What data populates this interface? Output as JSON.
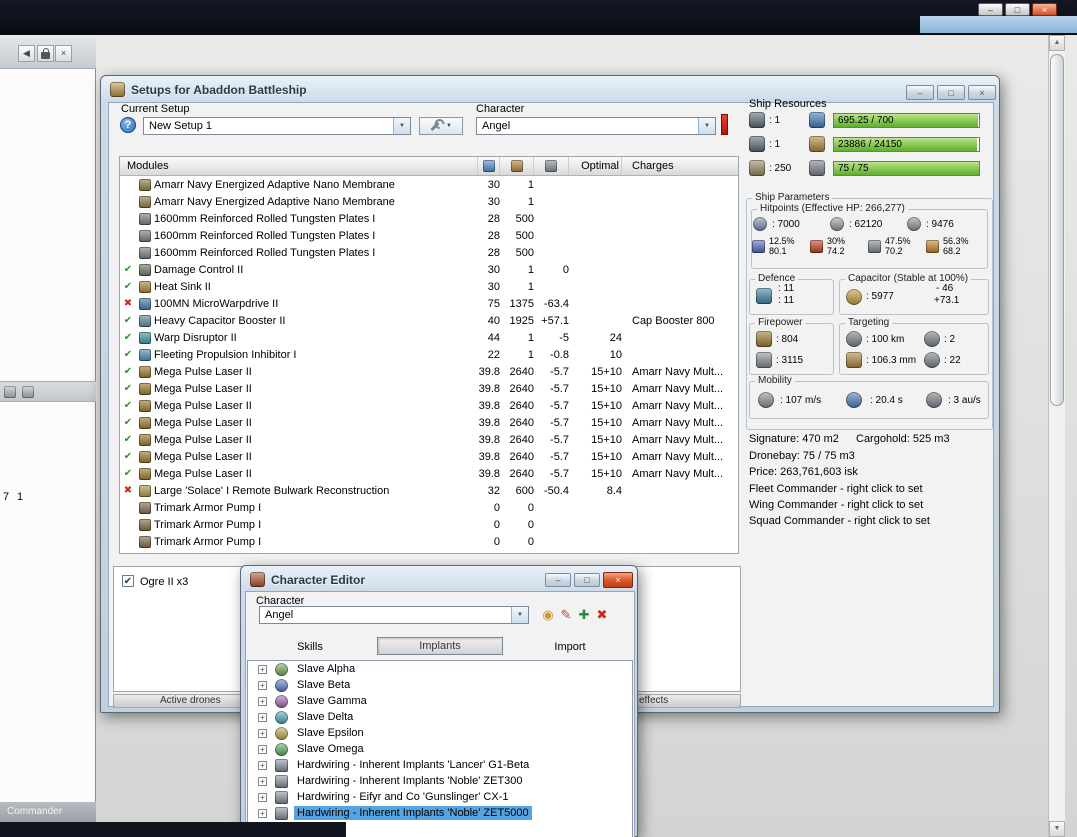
{
  "screen": {
    "topbar_buttons": {
      "minimize": "–",
      "maximize": "□",
      "close": "×"
    },
    "scrollbar": {
      "up": "▲",
      "down": "▼"
    }
  },
  "left_panel": {
    "back_button": "◀",
    "close_button": "×",
    "n1": "7",
    "n2": "1",
    "commander_label": "Commander"
  },
  "setup_window": {
    "title": "Setups for Abaddon Battleship",
    "window_buttons": {
      "minimize": "–",
      "maximize": "□",
      "close": "×"
    },
    "current_setup_label": "Current Setup",
    "current_setup_value": "New Setup 1",
    "character_label": "Character",
    "character_value": "Angel",
    "dropdown_arrow": "▼",
    "help_glyph": "?",
    "table": {
      "modules_header": "Modules",
      "optimal_header": "Optimal",
      "charges_header": "Charges",
      "rows": [
        {
          "st": "",
          "stc": "",
          "ic": "#93804a",
          "name": "Amarr Navy Energized Adaptive Nano Membrane",
          "cpu": "30",
          "pg": "1",
          "cap": "",
          "opt": "",
          "chg": ""
        },
        {
          "st": "",
          "stc": "",
          "ic": "#93804a",
          "name": "Amarr Navy Energized Adaptive Nano Membrane",
          "cpu": "30",
          "pg": "1",
          "cap": "",
          "opt": "",
          "chg": ""
        },
        {
          "st": "",
          "stc": "",
          "ic": "#7d828a",
          "name": "1600mm Reinforced Rolled Tungsten Plates I",
          "cpu": "28",
          "pg": "500",
          "cap": "",
          "opt": "",
          "chg": ""
        },
        {
          "st": "",
          "stc": "",
          "ic": "#7d828a",
          "name": "1600mm Reinforced Rolled Tungsten Plates I",
          "cpu": "28",
          "pg": "500",
          "cap": "",
          "opt": "",
          "chg": ""
        },
        {
          "st": "",
          "stc": "",
          "ic": "#7d828a",
          "name": "1600mm Reinforced Rolled Tungsten Plates I",
          "cpu": "28",
          "pg": "500",
          "cap": "",
          "opt": "",
          "chg": ""
        },
        {
          "st": "✔",
          "stc": "#1f9e1f",
          "ic": "#6f7d6a",
          "name": "Damage Control II",
          "cpu": "30",
          "pg": "1",
          "cap": "0",
          "opt": "",
          "chg": ""
        },
        {
          "st": "✔",
          "stc": "#1f9e1f",
          "ic": "#b08a3a",
          "name": "Heat Sink II",
          "cpu": "30",
          "pg": "1",
          "cap": "",
          "opt": "",
          "chg": ""
        },
        {
          "st": "✖",
          "stc": "#cc2a1a",
          "ic": "#4a7fb5",
          "name": "100MN MicroWarpdrive II",
          "cpu": "75",
          "pg": "1375",
          "cap": "-63.4",
          "opt": "",
          "chg": ""
        },
        {
          "st": "✔",
          "stc": "#1f9e1f",
          "ic": "#5f8fa5",
          "name": "Heavy Capacitor Booster II",
          "cpu": "40",
          "pg": "1925",
          "cap": "+57.1",
          "opt": "",
          "chg": "Cap Booster 800"
        },
        {
          "st": "✔",
          "stc": "#1f9e1f",
          "ic": "#3f9fa5",
          "name": "Warp Disruptor II",
          "cpu": "44",
          "pg": "1",
          "cap": "-5",
          "opt": "24",
          "chg": ""
        },
        {
          "st": "✔",
          "stc": "#1f9e1f",
          "ic": "#4f95b5",
          "name": "Fleeting Propulsion Inhibitor I",
          "cpu": "22",
          "pg": "1",
          "cap": "-0.8",
          "opt": "10",
          "chg": ""
        },
        {
          "st": "✔",
          "stc": "#1f9e1f",
          "ic": "#a08030",
          "name": "Mega Pulse Laser II",
          "cpu": "39.8",
          "pg": "2640",
          "cap": "-5.7",
          "opt": "15+10",
          "chg": "Amarr Navy Mult..."
        },
        {
          "st": "✔",
          "stc": "#1f9e1f",
          "ic": "#a08030",
          "name": "Mega Pulse Laser II",
          "cpu": "39.8",
          "pg": "2640",
          "cap": "-5.7",
          "opt": "15+10",
          "chg": "Amarr Navy Mult..."
        },
        {
          "st": "✔",
          "stc": "#1f9e1f",
          "ic": "#a08030",
          "name": "Mega Pulse Laser II",
          "cpu": "39.8",
          "pg": "2640",
          "cap": "-5.7",
          "opt": "15+10",
          "chg": "Amarr Navy Mult..."
        },
        {
          "st": "✔",
          "stc": "#1f9e1f",
          "ic": "#a08030",
          "name": "Mega Pulse Laser II",
          "cpu": "39.8",
          "pg": "2640",
          "cap": "-5.7",
          "opt": "15+10",
          "chg": "Amarr Navy Mult..."
        },
        {
          "st": "✔",
          "stc": "#1f9e1f",
          "ic": "#a08030",
          "name": "Mega Pulse Laser II",
          "cpu": "39.8",
          "pg": "2640",
          "cap": "-5.7",
          "opt": "15+10",
          "chg": "Amarr Navy Mult..."
        },
        {
          "st": "✔",
          "stc": "#1f9e1f",
          "ic": "#a08030",
          "name": "Mega Pulse Laser II",
          "cpu": "39.8",
          "pg": "2640",
          "cap": "-5.7",
          "opt": "15+10",
          "chg": "Amarr Navy Mult..."
        },
        {
          "st": "✔",
          "stc": "#1f9e1f",
          "ic": "#a08030",
          "name": "Mega Pulse Laser II",
          "cpu": "39.8",
          "pg": "2640",
          "cap": "-5.7",
          "opt": "15+10",
          "chg": "Amarr Navy Mult..."
        },
        {
          "st": "✖",
          "stc": "#cc2a1a",
          "ic": "#b0a04a",
          "name": "Large 'Solace' I Remote Bulwark Reconstruction",
          "cpu": "32",
          "pg": "600",
          "cap": "-50.4",
          "opt": "8.4",
          "chg": ""
        },
        {
          "st": "",
          "stc": "",
          "ic": "#8a6f4f",
          "name": "Trimark Armor Pump I",
          "cpu": "0",
          "pg": "0",
          "cap": "",
          "opt": "",
          "chg": ""
        },
        {
          "st": "",
          "stc": "",
          "ic": "#8a6f4f",
          "name": "Trimark Armor Pump I",
          "cpu": "0",
          "pg": "0",
          "cap": "",
          "opt": "",
          "chg": ""
        },
        {
          "st": "",
          "stc": "",
          "ic": "#8a6f4f",
          "name": "Trimark Armor Pump I",
          "cpu": "0",
          "pg": "0",
          "cap": "",
          "opt": "",
          "chg": ""
        }
      ]
    },
    "drones": {
      "item_label": "Ogre II x3",
      "checked_glyph": "✔",
      "footer_left": "Active drones",
      "footer_right": "effects"
    },
    "resources": {
      "title": "Ship Resources",
      "rows": [
        {
          "count": ": 1",
          "ic1": "#5f6c78",
          "ic2": "#3f7fc0",
          "bar": "695.25 / 700",
          "fill": "99.3%"
        },
        {
          "count": ": 1",
          "ic1": "#5f6c78",
          "ic2": "#b5893f",
          "bar": "23886 / 24150",
          "fill": "98.9%"
        },
        {
          "count": ": 250",
          "ic1": "#9a8f5f",
          "ic2": "#7d848c",
          "bar": "75 / 75",
          "fill": "100%"
        }
      ]
    },
    "parameters": {
      "title": "Ship Parameters",
      "hitpoints_title": "Hitpoints (Effective HP: 266,277)",
      "hp": [
        {
          "v": ": 7000",
          "ic": "#7a94b8"
        },
        {
          "v": ": 62120",
          "ic": "#9aa0a8"
        },
        {
          "v": ": 9476",
          "ic": "#8f97a0"
        }
      ],
      "resists": [
        {
          "pct": "12.5%",
          "val": "80.1",
          "ic": "#5b6fc8"
        },
        {
          "pct": "30%",
          "val": "74.2",
          "ic": "#cc4422"
        },
        {
          "pct": "47.5%",
          "val": "70.2",
          "ic": "#888f98"
        },
        {
          "pct": "56.3%",
          "val": "68.2",
          "ic": "#d08828"
        }
      ],
      "defence": {
        "title": "Defence",
        "v1": ": 11",
        "v2": ": 11"
      },
      "capacitor": {
        "title": "Capacitor (Stable at 100%)",
        "v1": ": 5977",
        "v2": "- 46",
        "v3": "+73.1"
      },
      "firepower": {
        "title": "Firepower",
        "v1": ": 804",
        "v2": ": 3115"
      },
      "targeting": {
        "title": "Targeting",
        "v1": ": 100 km",
        "v2": ": 2",
        "v3": ": 106.3 mm",
        "v4": ": 22"
      },
      "mobility": {
        "title": "Mobility",
        "v1": ": 107 m/s",
        "v2": ": 20.4 s",
        "v3": ": 3 au/s"
      }
    },
    "stats": {
      "signature": "Signature: 470 m2",
      "cargohold": "Cargohold: 525 m3",
      "dronebay": "Dronebay: 75 / 75 m3",
      "price": "Price: 263,761,603 isk",
      "fleet_commander": "Fleet Commander - right click to set",
      "wing_commander": "Wing Commander - right click to set",
      "squad_commander": "Squad Commander - right click to set"
    }
  },
  "character_editor": {
    "title": "Character Editor",
    "window_buttons": {
      "minimize": "–",
      "maximize": "□",
      "close": "×"
    },
    "character_label": "Character",
    "character_value": "Angel",
    "dropdown_arrow": "▼",
    "expander_glyph": "+",
    "tabs": {
      "skills": "Skills",
      "implants": "Implants",
      "import": "Import"
    },
    "actions": [
      {
        "glyph": "◉",
        "color": "#c89a2f"
      },
      {
        "glyph": "✎",
        "color": "#a0522d"
      },
      {
        "glyph": "✚",
        "color": "#2e8b2e"
      },
      {
        "glyph": "✖",
        "color": "#cc2a1a"
      }
    ],
    "implants": [
      {
        "name": "Slave Alpha",
        "ic": "#79b05a",
        "br": "50%",
        "bg": ""
      },
      {
        "name": "Slave Beta",
        "ic": "#5a7fd0",
        "br": "50%",
        "bg": ""
      },
      {
        "name": "Slave Gamma",
        "ic": "#b06ab0",
        "br": "50%",
        "bg": ""
      },
      {
        "name": "Slave Delta",
        "ic": "#4fb0c0",
        "br": "50%",
        "bg": ""
      },
      {
        "name": "Slave Epsilon",
        "ic": "#c0b04f",
        "br": "50%",
        "bg": ""
      },
      {
        "name": "Slave Omega",
        "ic": "#5ab06a",
        "br": "50%",
        "bg": ""
      },
      {
        "name": "Hardwiring - Inherent Implants 'Lancer' G1-Beta",
        "ic": "#8a93a3",
        "br": "2px",
        "bg": ""
      },
      {
        "name": "Hardwiring - Inherent Implants 'Noble' ZET300",
        "ic": "#8a93a3",
        "br": "2px",
        "bg": ""
      },
      {
        "name": "Hardwiring - Eifyr and Co 'Gunslinger' CX-1",
        "ic": "#8a93a3",
        "br": "2px",
        "bg": ""
      },
      {
        "name": "Hardwiring - Inherent Implants 'Noble' ZET5000",
        "ic": "#8a93a3",
        "br": "2px",
        "bg": "#55a4e0"
      }
    ]
  }
}
